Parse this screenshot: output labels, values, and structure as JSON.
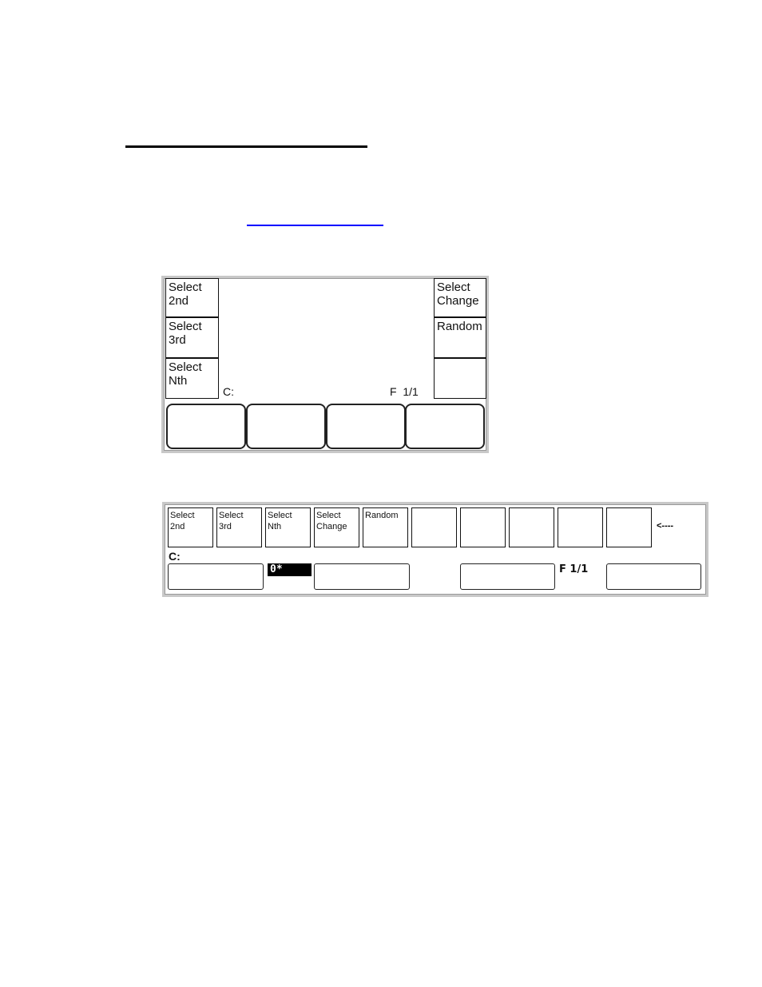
{
  "panel_vertical": {
    "left_buttons": [
      "Select\n2nd",
      "Select\n3rd",
      "Select\nNth"
    ],
    "right_buttons": [
      "Select\nChange",
      "Random",
      ""
    ],
    "channel_label": "C:",
    "page_label": "F  1/1"
  },
  "panel_horizontal": {
    "top_buttons": [
      "Select\n2nd",
      "Select\n3rd",
      "Select\nNth",
      "Select\nChange",
      "Random",
      "",
      "",
      "",
      "",
      ""
    ],
    "arrow": "<----",
    "channel_label": "C:",
    "highlight_value": "0*",
    "page_label": "F 1/1"
  }
}
